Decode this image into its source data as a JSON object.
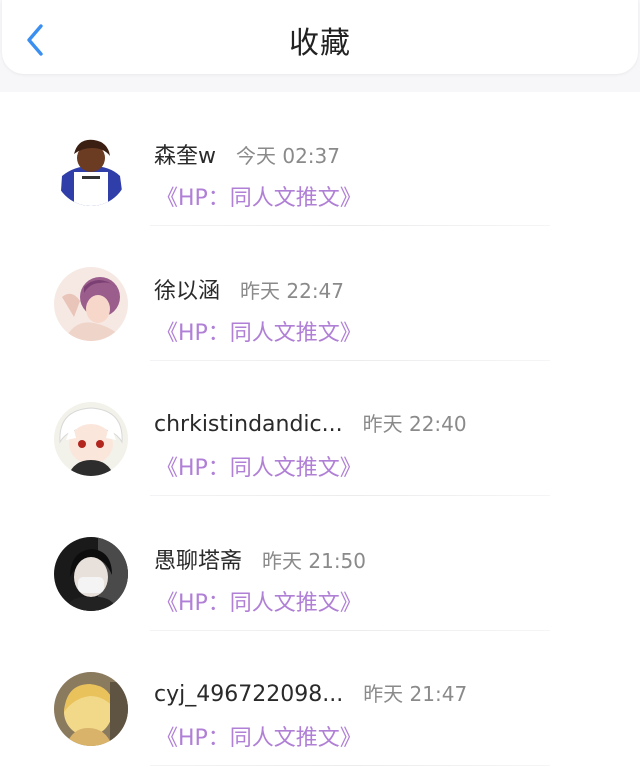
{
  "header": {
    "title": "收藏",
    "back_icon": "chevron-left-icon",
    "accent": "#3a8ff0"
  },
  "colors": {
    "book_link": "#b07fd6",
    "time_text": "#8a8a8a"
  },
  "favorites": [
    {
      "name": "森奎w",
      "time": "今天 02:37",
      "book": "《HP：同人文推文》",
      "avatar": "avatar-icon"
    },
    {
      "name": "徐以涵",
      "time": "昨天 22:47",
      "book": "《HP：同人文推文》",
      "avatar": "avatar-icon"
    },
    {
      "name": "chrkistindandic...",
      "time": "昨天 22:40",
      "book": "《HP：同人文推文》",
      "avatar": "avatar-icon"
    },
    {
      "name": "愚聊塔斋",
      "time": "昨天 21:50",
      "book": "《HP：同人文推文》",
      "avatar": "avatar-icon"
    },
    {
      "name": "cyj_496722098...",
      "time": "昨天 21:47",
      "book": "《HP：同人文推文》",
      "avatar": "avatar-icon"
    }
  ]
}
